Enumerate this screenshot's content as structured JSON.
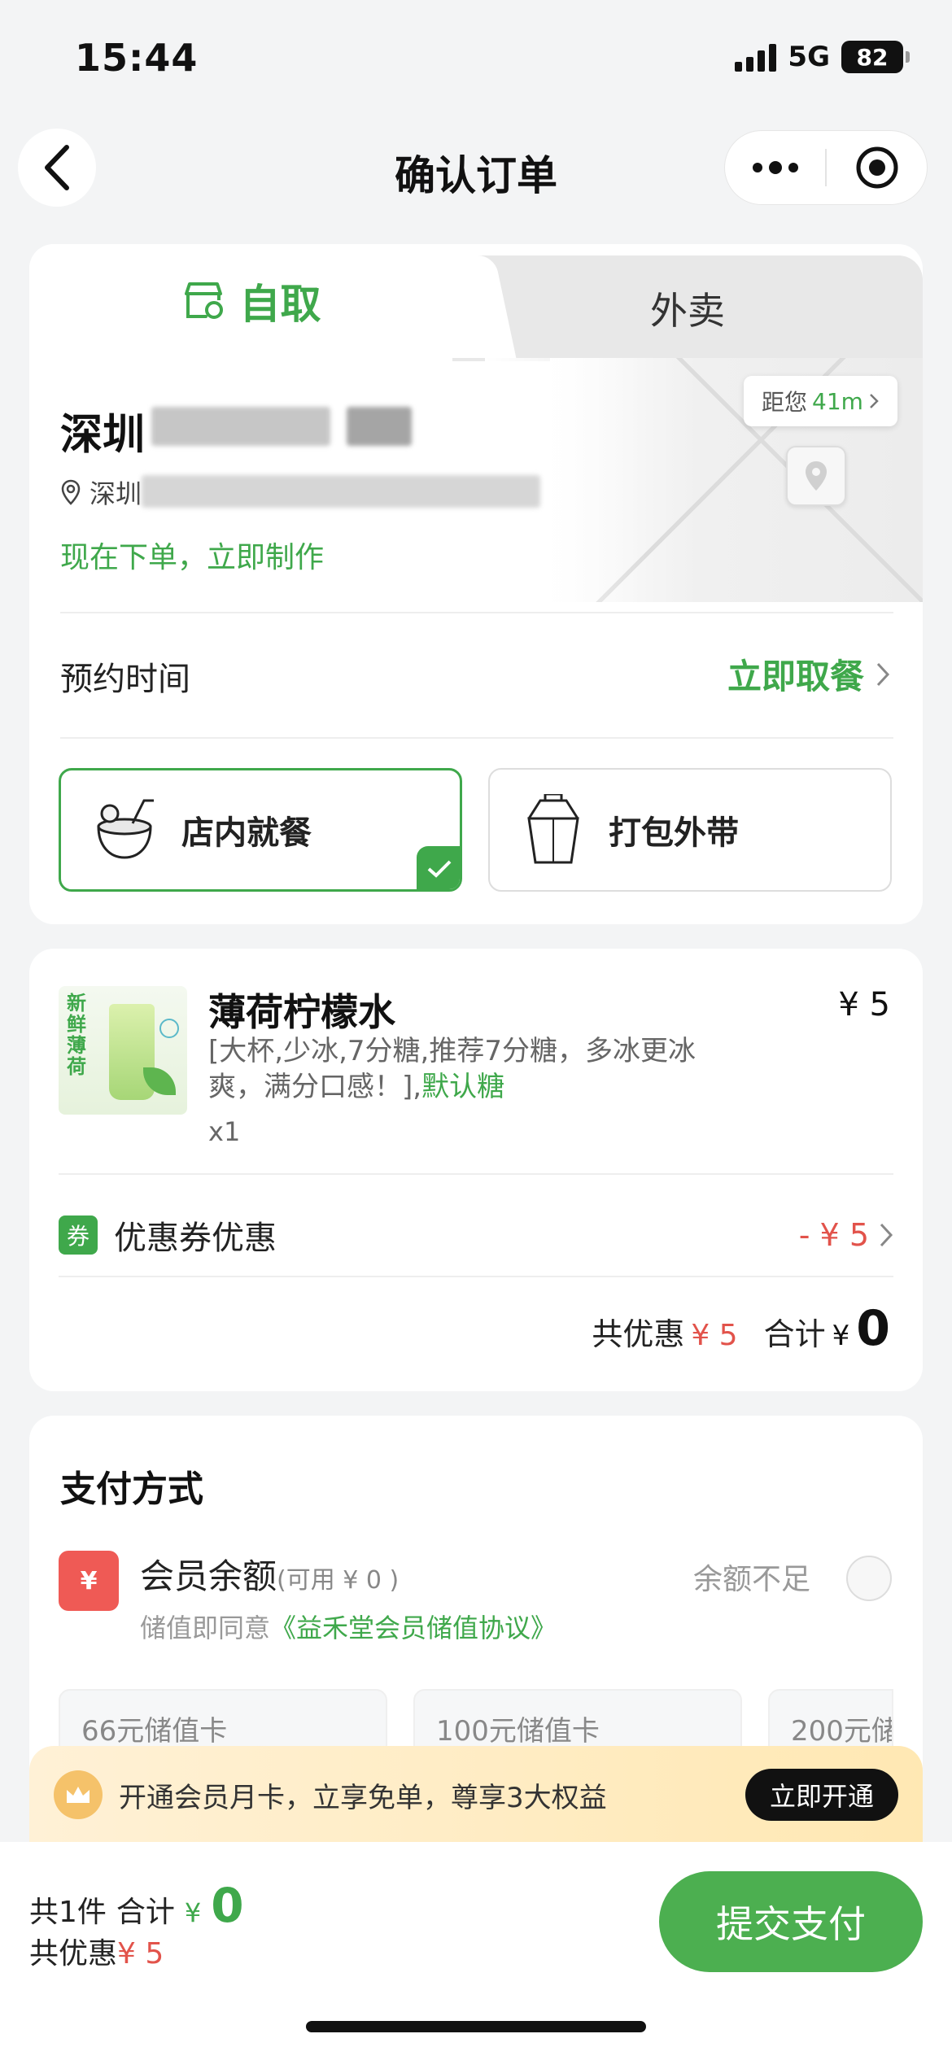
{
  "status_bar": {
    "time": "15:44",
    "network": "5G",
    "battery": "82"
  },
  "nav": {
    "title": "确认订单"
  },
  "tabs": {
    "pickup": "自取",
    "delivery": "外卖"
  },
  "store": {
    "name": "深圳",
    "address": "深圳",
    "distance_prefix": "距您",
    "distance": "41m",
    "status_text": "现在下单，立即制作"
  },
  "schedule": {
    "label": "预约时间",
    "value": "立即取餐"
  },
  "dining": {
    "dine_in": "店内就餐",
    "take_out": "打包外带"
  },
  "product": {
    "image_text": "新鲜薄荷",
    "name": "薄荷柠檬水",
    "price": "¥ 5",
    "desc": "[大杯,少冰,7分糖,推荐7分糖，多冰更冰爽，满分口感！],",
    "desc_highlight": "默认糖",
    "qty": "x1"
  },
  "coupon": {
    "badge": "券",
    "label": "优惠券优惠",
    "value": "- ¥ 5"
  },
  "order_total": {
    "discount_label": "共优惠",
    "discount_value": "¥ 5",
    "total_label": "合计",
    "currency": "¥",
    "total_value": "0"
  },
  "payment": {
    "title": "支付方式",
    "wallet_icon": "¥",
    "wallet_label": "会员余额",
    "wallet_available": "(可用 ¥ 0 )",
    "agree_prefix": "储值即同意",
    "agree_link": "《益禾堂会员储值协议》",
    "insufficient": "余额不足",
    "cards": [
      "66元储值卡",
      "100元储值卡",
      "200元储"
    ]
  },
  "member_banner": {
    "text": "开通会员月卡，立享免单，尊享3大权益",
    "button": "立即开通"
  },
  "bottom_bar": {
    "count": "共1件",
    "total_label": "合计",
    "currency": "¥",
    "total_value": "0",
    "discount_label": "共优惠",
    "discount_value": "¥ 5",
    "submit": "提交支付"
  },
  "colors": {
    "accent_green": "#3fa84b",
    "price_red": "#e2534b",
    "background": "#f3f4f5"
  }
}
